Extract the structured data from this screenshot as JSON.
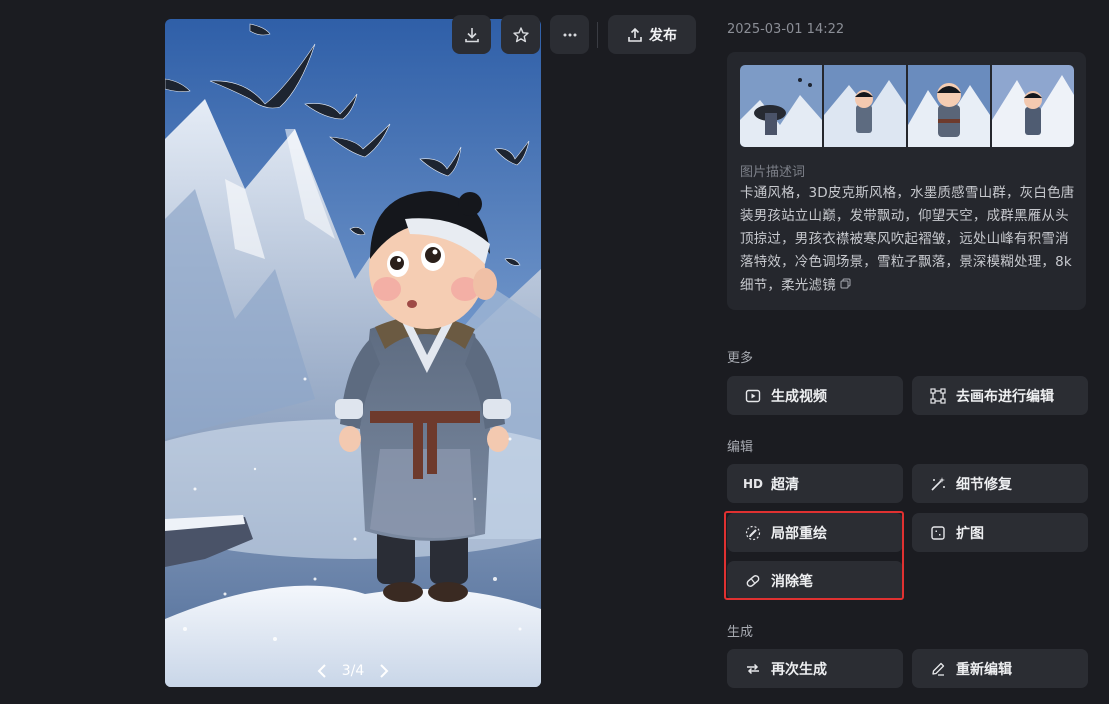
{
  "toolbar": {
    "download_icon": "download-icon",
    "favorite_icon": "star-icon",
    "more_icon": "more-horizontal-icon",
    "publish_label": "发布"
  },
  "image_viewer": {
    "page_indicator": "3/4"
  },
  "info_panel": {
    "timestamp": "2025-03-01 14:22",
    "prompt_label": "图片描述词",
    "prompt_text": "卡通风格，3D皮克斯风格，水墨质感雪山群，灰白色唐装男孩站立山巅，发带飘动，仰望天空，成群黑雁从头顶掠过，男孩衣襟被寒风吹起褶皱，远处山峰有积雪消落特效，冷色调场景，雪粒子飘落，景深模糊处理，8k细节，柔光滤镜"
  },
  "sections": {
    "more": {
      "label": "更多",
      "buttons": [
        {
          "label": "生成视频",
          "icon": "video-play-icon"
        },
        {
          "label": "去画布进行编辑",
          "icon": "canvas-icon"
        }
      ]
    },
    "edit": {
      "label": "编辑",
      "buttons": [
        {
          "label": "超清",
          "icon": "HD"
        },
        {
          "label": "细节修复",
          "icon": "magic-wand-icon"
        },
        {
          "label": "局部重绘",
          "icon": "brush-icon"
        },
        {
          "label": "扩图",
          "icon": "expand-icon"
        },
        {
          "label": "消除笔",
          "icon": "eraser-icon"
        }
      ]
    },
    "generate": {
      "label": "生成",
      "buttons": [
        {
          "label": "再次生成",
          "icon": "regenerate-icon"
        },
        {
          "label": "重新编辑",
          "icon": "pencil-icon"
        }
      ]
    }
  },
  "colors": {
    "background": "#1b1c21",
    "button": "#2b2d33",
    "card": "#25272d",
    "highlight": "#e03131"
  }
}
